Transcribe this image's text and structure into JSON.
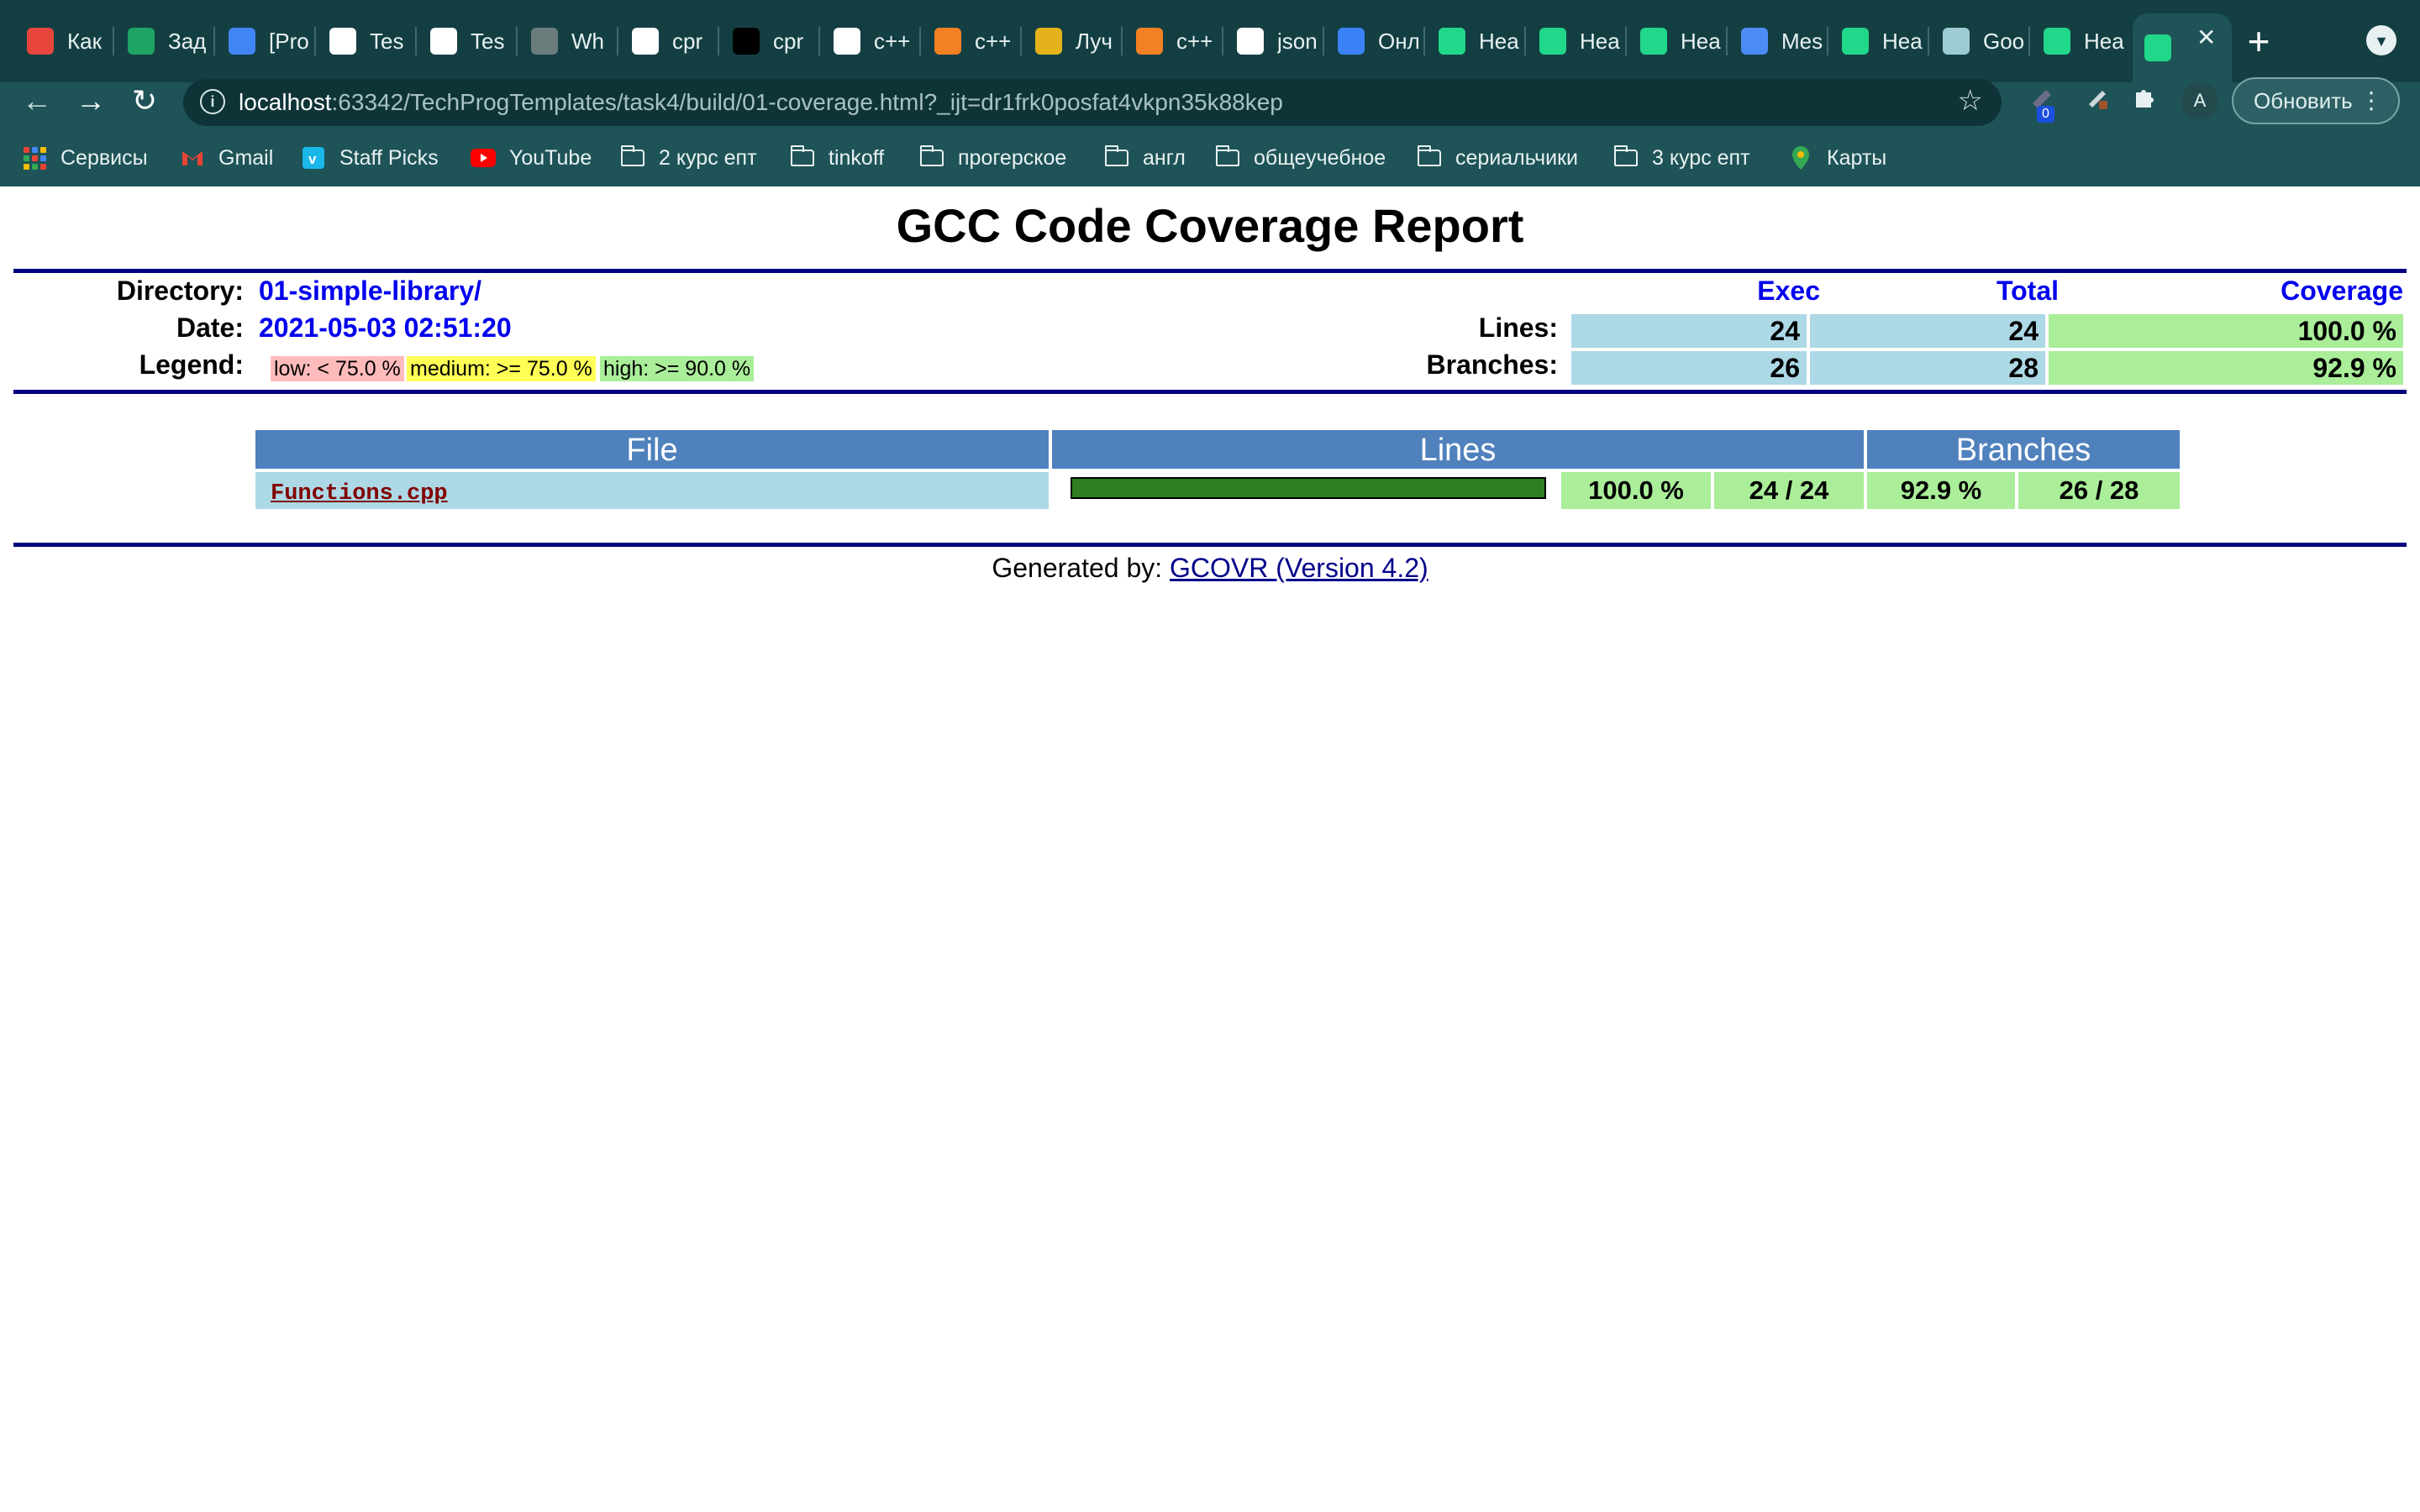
{
  "browser": {
    "tabs": [
      {
        "label": "Как",
        "icon": "code-icon",
        "color": "#e8453c"
      },
      {
        "label": "Зад",
        "icon": "google-drive-icon",
        "color": "#1fa463"
      },
      {
        "label": "[Pro",
        "icon": "google-docs-icon",
        "color": "#4285f4"
      },
      {
        "label": "Tes",
        "icon": "github-icon",
        "color": "#ffffff"
      },
      {
        "label": "Tes",
        "icon": "github-icon",
        "color": "#ffffff"
      },
      {
        "label": "Wh",
        "icon": "globe-icon",
        "color": "#6b7c7d"
      },
      {
        "label": "cpr",
        "icon": "google-icon",
        "color": "#ffffff"
      },
      {
        "label": "cpr",
        "icon": "plus-icon",
        "color": "#000000"
      },
      {
        "label": "c++",
        "icon": "google-icon",
        "color": "#ffffff"
      },
      {
        "label": "c++",
        "icon": "stackoverflow-icon",
        "color": "#f48024"
      },
      {
        "label": "Луч",
        "icon": "site-icon",
        "color": "#e4b21b"
      },
      {
        "label": "c++",
        "icon": "stackoverflow-icon",
        "color": "#f48024"
      },
      {
        "label": "json",
        "icon": "google-icon",
        "color": "#ffffff"
      },
      {
        "label": "Онл",
        "icon": "html-icon",
        "color": "#3b82f6"
      },
      {
        "label": "Hea",
        "icon": "clion-icon",
        "color": "#21d789"
      },
      {
        "label": "Hea",
        "icon": "clion-icon",
        "color": "#21d789"
      },
      {
        "label": "Hea",
        "icon": "clion-icon",
        "color": "#21d789"
      },
      {
        "label": "Mes",
        "icon": "messages-icon",
        "color": "#4c8bf5"
      },
      {
        "label": "Hea",
        "icon": "clion-icon",
        "color": "#21d789"
      },
      {
        "label": "Goo",
        "icon": "google-colab-icon",
        "color": "#9ecbd3"
      },
      {
        "label": "Hea",
        "icon": "clion-icon",
        "color": "#21d789"
      },
      {
        "label": "",
        "icon": "clion-icon",
        "color": "#21d789",
        "active": true
      }
    ],
    "url_host": "localhost",
    "url_rest": ":63342/TechProgTemplates/task4/build/01-coverage.html?_ijt=dr1frk0posfat4vkpn35k88kep",
    "extension_badge": "0",
    "avatar_letter": "A",
    "update_label": "Обновить",
    "bookmarks": [
      {
        "label": "Сервисы",
        "icon": "apps-grid-icon"
      },
      {
        "label": "Gmail",
        "icon": "gmail-icon"
      },
      {
        "label": "Staff Picks",
        "icon": "vimeo-icon"
      },
      {
        "label": "YouTube",
        "icon": "youtube-icon"
      },
      {
        "label": "2 курс епт",
        "icon": "folder-icon"
      },
      {
        "label": "tinkoff",
        "icon": "folder-icon"
      },
      {
        "label": "прогерское",
        "icon": "folder-icon"
      },
      {
        "label": "англ",
        "icon": "folder-icon"
      },
      {
        "label": "общеучебное",
        "icon": "folder-icon"
      },
      {
        "label": "сериальчики",
        "icon": "folder-icon"
      },
      {
        "label": "3 курс епт",
        "icon": "folder-icon"
      },
      {
        "label": "Карты",
        "icon": "maps-pin-icon"
      }
    ]
  },
  "report": {
    "title": "GCC Code Coverage Report",
    "directory_label": "Directory:",
    "directory": "01-simple-library/",
    "date_label": "Date:",
    "date": "2021-05-03 02:51:20",
    "legend_label": "Legend:",
    "legend": {
      "low": "low: < 75.0 %",
      "medium": "medium: >= 75.0 %",
      "high": "high: >= 90.0 %"
    },
    "summary": {
      "col_exec": "Exec",
      "col_total": "Total",
      "col_coverage": "Coverage",
      "lines_label": "Lines:",
      "lines_exec": "24",
      "lines_total": "24",
      "lines_coverage": "100.0 %",
      "branches_label": "Branches:",
      "branches_exec": "26",
      "branches_total": "28",
      "branches_coverage": "92.9 %"
    },
    "table": {
      "headers": {
        "file": "File",
        "lines": "Lines",
        "branches": "Branches"
      },
      "rows": [
        {
          "file": "Functions.cpp",
          "line_fraction": 1.0,
          "line_percent": "100.0 %",
          "line_ratio": "24 / 24",
          "branch_percent": "92.9 %",
          "branch_ratio": "26 / 28"
        }
      ]
    },
    "footer_prefix": "Generated by: ",
    "footer_link": "GCOVR (Version 4.2)"
  },
  "colors": {
    "low": "#ffbbbb",
    "medium": "#ffff55",
    "high": "#aaee99",
    "count_bg": "#add8e6",
    "header_bg": "#4f81bd",
    "rule": "#000080",
    "link": "#0000ee"
  }
}
